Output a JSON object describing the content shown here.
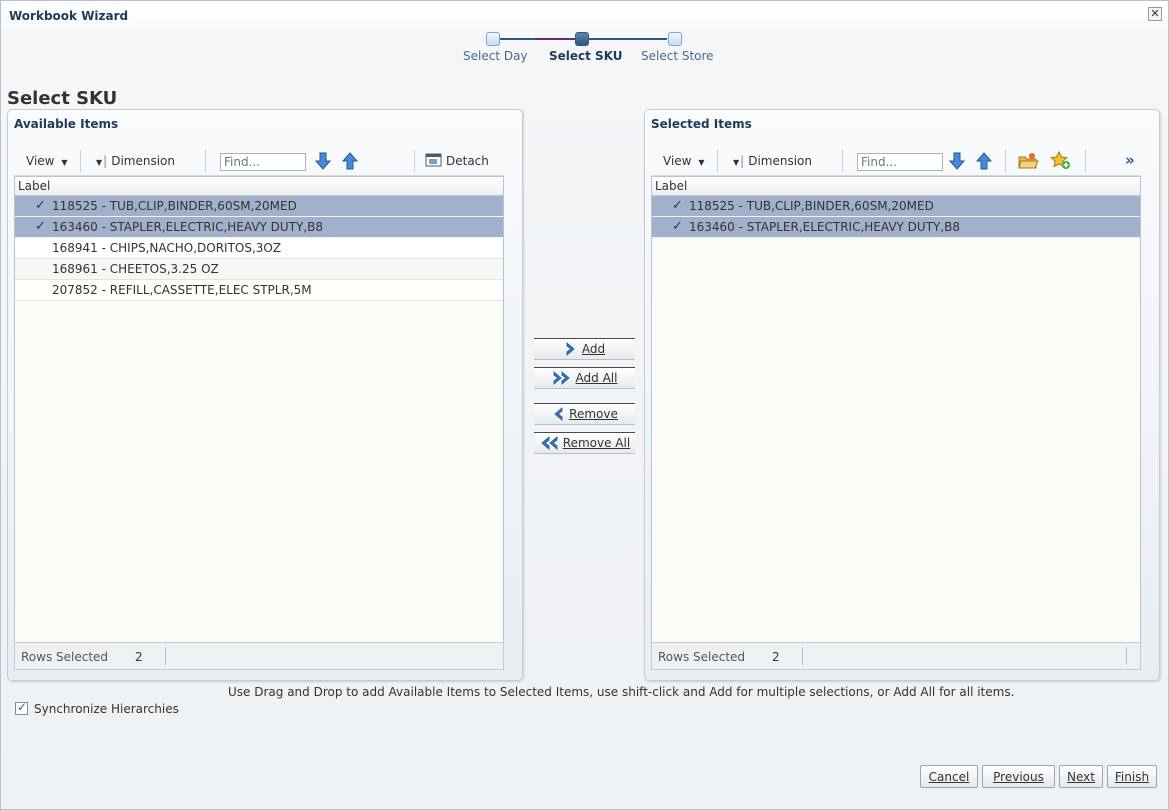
{
  "window": {
    "title": "Workbook Wizard",
    "close_glyph": "✕"
  },
  "train": {
    "steps": [
      {
        "label": "Select Day",
        "state": "visited"
      },
      {
        "label": "Select SKU",
        "state": "current"
      },
      {
        "label": "Select Store",
        "state": "unvisited"
      }
    ]
  },
  "page": {
    "title": "Select SKU"
  },
  "available": {
    "header": "Available Items",
    "toolbar": {
      "view_label": "View",
      "dimension_label": "Dimension",
      "find_placeholder": "Find...",
      "detach_label": "Detach"
    },
    "column_label": "Label",
    "rows": [
      {
        "label": "118525 - TUB,CLIP,BINDER,60SM,20MED",
        "selected": true
      },
      {
        "label": "163460 - STAPLER,ELECTRIC,HEAVY DUTY,B8",
        "selected": true
      },
      {
        "label": "168941 - CHIPS,NACHO,DORITOS,3OZ",
        "selected": false
      },
      {
        "label": "168961 - CHEETOS,3.25 OZ",
        "selected": false
      },
      {
        "label": "207852 - REFILL,CASSETTE,ELEC STPLR,5M",
        "selected": false
      }
    ],
    "status": {
      "label": "Rows Selected",
      "count": "2"
    }
  },
  "selected": {
    "header": "Selected Items",
    "toolbar": {
      "view_label": "View",
      "dimension_label": "Dimension",
      "find_placeholder": "Find...",
      "more_glyph": "»"
    },
    "column_label": "Label",
    "rows": [
      {
        "label": "118525 - TUB,CLIP,BINDER,60SM,20MED",
        "selected": true
      },
      {
        "label": "163460 - STAPLER,ELECTRIC,HEAVY DUTY,B8",
        "selected": true
      }
    ],
    "status": {
      "label": "Rows Selected",
      "count": "2"
    }
  },
  "shuttle": {
    "add": "Add",
    "add_all": "Add All",
    "remove": "Remove",
    "remove_all": "Remove All"
  },
  "hint": "Use Drag and Drop to add Available Items to Selected Items, use shift-click and Add for multiple selections, or Add All for all items.",
  "sync": {
    "label": "Synchronize Hierarchies",
    "checked": true
  },
  "footer": {
    "cancel": "Cancel",
    "previous": "Previous",
    "next": "Next",
    "finish": "Finish"
  },
  "check_glyph": "✓",
  "colors": {
    "accent": "#1f3b57",
    "row_selected": "#a2b1cb",
    "table_bg": "#fcfdf7",
    "train_active": "#2e5882",
    "train_connector": "#6a2a6a"
  }
}
